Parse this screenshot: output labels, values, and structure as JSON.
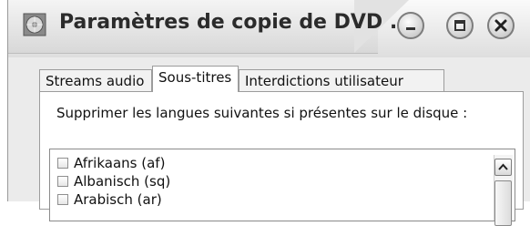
{
  "window": {
    "title": "Paramètres de copie de DVD ...",
    "icons": {
      "app": "dvd-icon",
      "minimize": "minimize-icon",
      "maximize": "maximize-icon",
      "close": "close-icon"
    }
  },
  "tabs": [
    {
      "label": "Streams audio",
      "active": false
    },
    {
      "label": "Sous-titres",
      "active": true
    },
    {
      "label": "Interdictions utilisateur",
      "active": false
    }
  ],
  "panel": {
    "instruction": "Supprimer les langues suivantes si présentes sur le disque :",
    "languages": [
      {
        "label": "Afrikaans (af)",
        "checked": false
      },
      {
        "label": "Albanisch (sq)",
        "checked": false
      },
      {
        "label": "Arabisch (ar)",
        "checked": false
      }
    ]
  }
}
